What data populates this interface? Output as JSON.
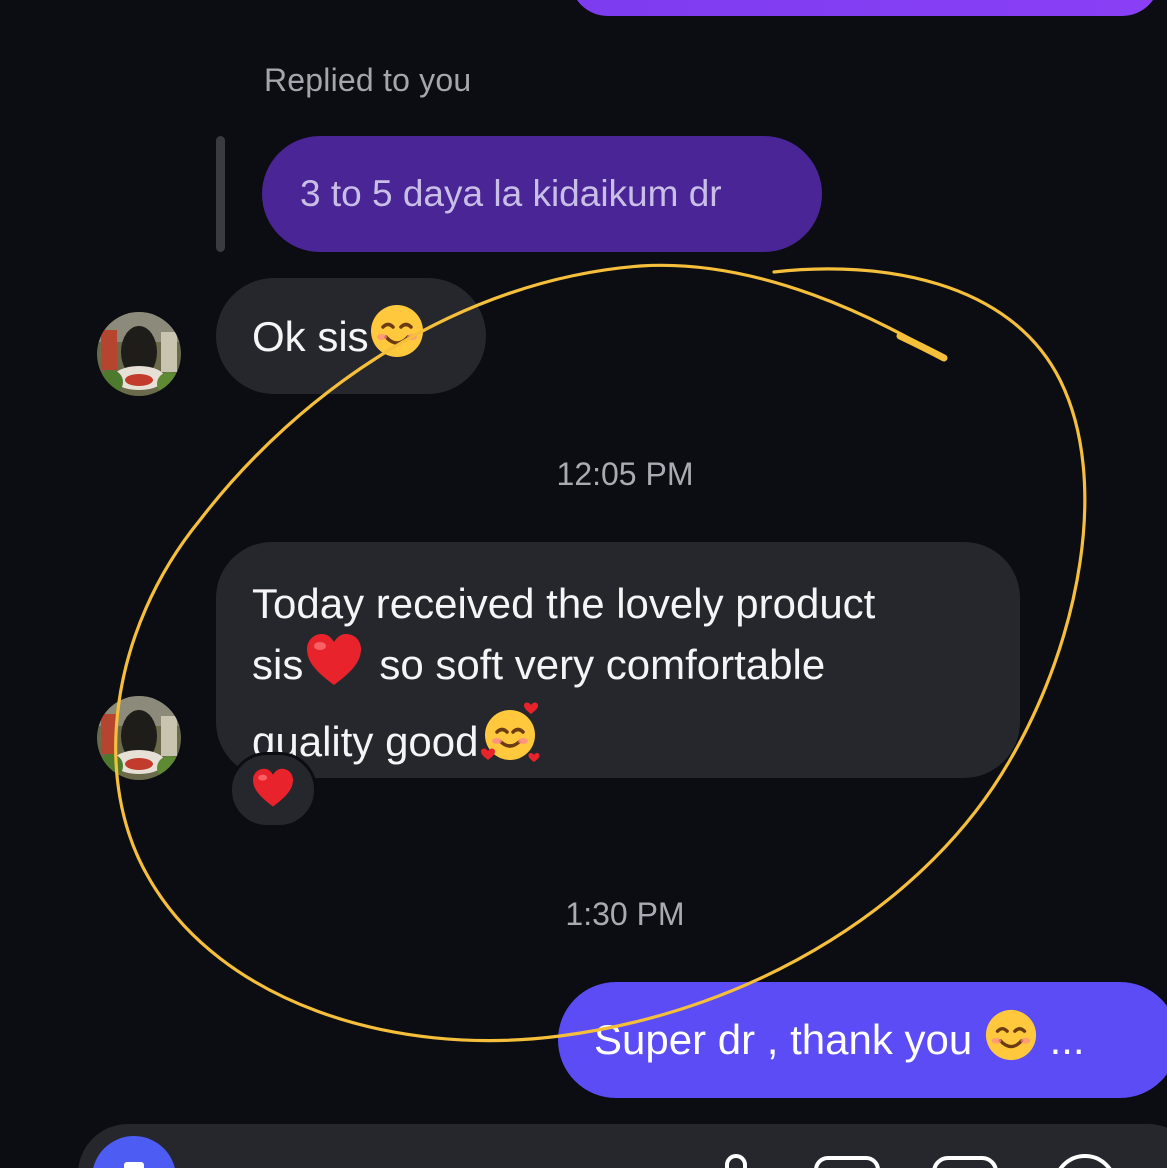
{
  "thread": {
    "reply_label": "Replied to you",
    "replied_message": "3 to 5 daya la kidaikum dr",
    "messages": [
      {
        "text": "Ok sis",
        "emoji": "smiling-face-icon"
      },
      {
        "lines": [
          "Today received the lovely product",
          "sis",
          "so soft very comfortable",
          "quality good"
        ],
        "emojis": [
          "red-heart-icon",
          "smiling-face-with-hearts-icon"
        ],
        "reaction": "red-heart-icon"
      }
    ],
    "timestamps": [
      "12:05 PM",
      "1:30 PM"
    ],
    "sent_message": {
      "text": "Super dr , thank you",
      "emoji": "smiling-face-icon",
      "overflow": "..."
    }
  },
  "composer": {
    "buttons": [
      "camera-icon",
      "microphone-icon",
      "image-icon",
      "sticker-icon",
      "plus-icon"
    ]
  },
  "colors": {
    "background": "#0b0d12",
    "incoming_bubble": "#26272c",
    "outgoing_bubble": "#5b4cf5",
    "replied_bubble": "#4a2596",
    "annotation": "#f5bf3c"
  }
}
